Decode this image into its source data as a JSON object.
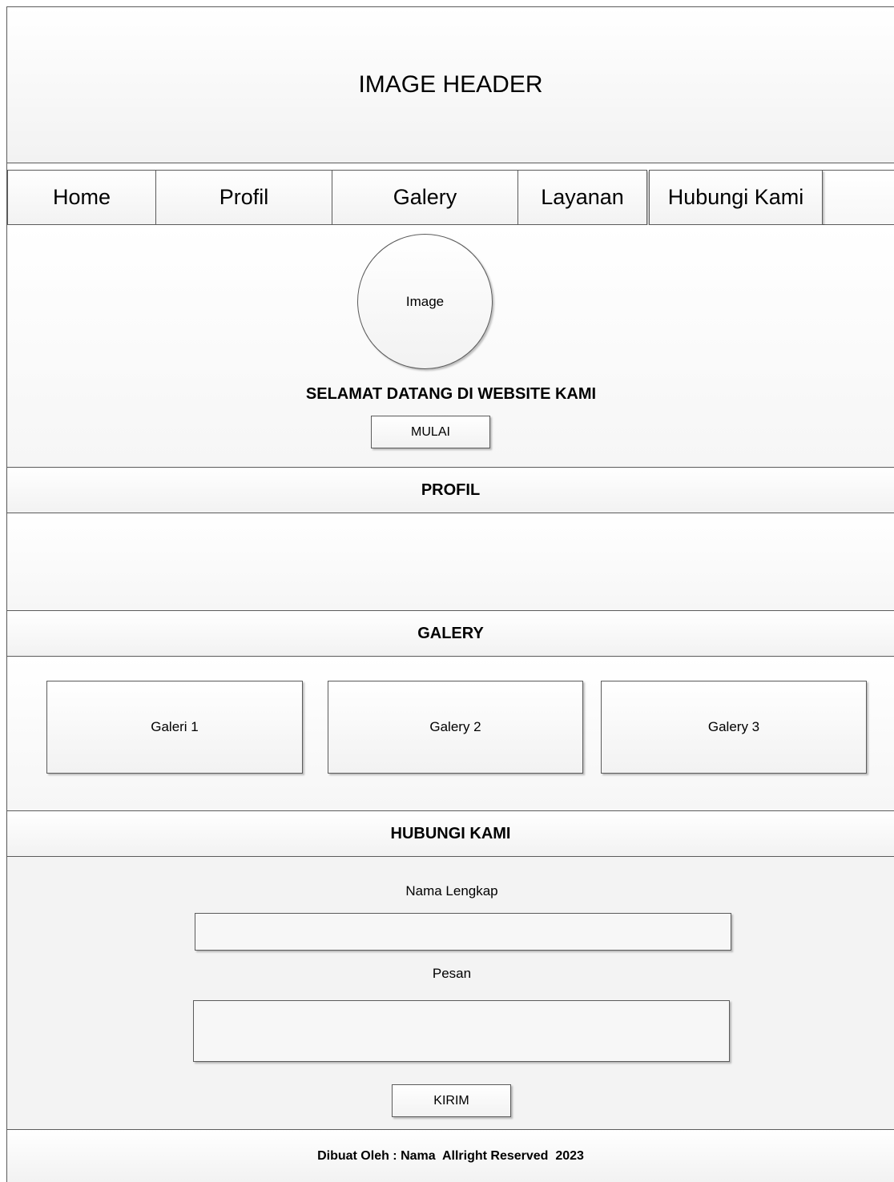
{
  "header": {
    "title": "IMAGE HEADER"
  },
  "nav": {
    "items": [
      {
        "label": "Home"
      },
      {
        "label": "Profil"
      },
      {
        "label": "Galery"
      },
      {
        "label": "Layanan"
      },
      {
        "label": "Hubungi Kami"
      }
    ]
  },
  "hero": {
    "image_label": "Image",
    "welcome": "SELAMAT DATANG DI WEBSITE KAMI",
    "button": "MULAI"
  },
  "profil": {
    "title": "PROFIL"
  },
  "galery": {
    "title": "GALERY",
    "items": [
      {
        "label": "Galeri 1"
      },
      {
        "label": "Galery 2"
      },
      {
        "label": "Galery 3"
      }
    ]
  },
  "contact": {
    "title": "HUBUNGI KAMI",
    "name_label": "Nama Lengkap",
    "message_label": "Pesan",
    "submit": "KIRIM"
  },
  "footer": {
    "text": "Dibuat Oleh : Nama  Allright Reserved  2023"
  }
}
